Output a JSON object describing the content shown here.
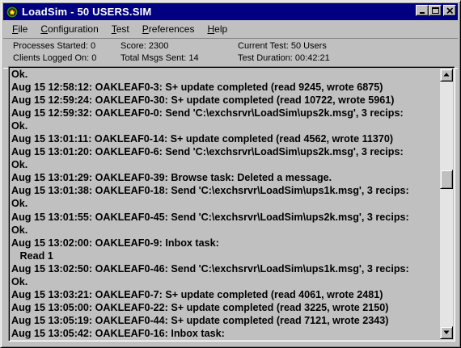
{
  "window": {
    "title": "LoadSim - 50 USERS.SIM",
    "icon": "loadsim-app-icon",
    "buttons": [
      "minimize-icon",
      "maximize-icon",
      "close-icon"
    ]
  },
  "menu": {
    "items": [
      {
        "label": "File",
        "accel": "F"
      },
      {
        "label": "Configuration",
        "accel": "C"
      },
      {
        "label": "Test",
        "accel": "T"
      },
      {
        "label": "Preferences",
        "accel": "P"
      },
      {
        "label": "Help",
        "accel": "H"
      }
    ]
  },
  "status": {
    "processes_started": "Processes Started: 0",
    "clients_logged_on": "Clients Logged On: 0",
    "score": "Score: 2300",
    "total_msgs_sent": "Total Msgs Sent: 14",
    "current_test": "Current Test: 50 Users",
    "test_duration": "Test Duration: 00:42:21"
  },
  "log": {
    "lines": [
      "Ok.",
      "Aug 15 12:58:12: OAKLEAF0-3: S+ update completed (read 9245, wrote 6875)",
      "Aug 15 12:59:24: OAKLEAF0-30: S+ update completed (read 10722, wrote 5961)",
      "Aug 15 12:59:32: OAKLEAF0-0: Send 'C:\\exchsrvr\\LoadSim\\ups2k.msg', 3 recips:",
      "Ok.",
      "Aug 15 13:01:11: OAKLEAF0-14: S+ update completed (read 4562, wrote 11370)",
      "Aug 15 13:01:20: OAKLEAF0-6: Send 'C:\\exchsrvr\\LoadSim\\ups2k.msg', 3 recips:",
      "Ok.",
      "Aug 15 13:01:29: OAKLEAF0-39: Browse task: Deleted a message.",
      "Aug 15 13:01:38: OAKLEAF0-18: Send 'C:\\exchsrvr\\LoadSim\\ups1k.msg', 3 recips:",
      "Ok.",
      "Aug 15 13:01:55: OAKLEAF0-45: Send 'C:\\exchsrvr\\LoadSim\\ups2k.msg', 3 recips:",
      "Ok.",
      "Aug 15 13:02:00: OAKLEAF0-9: Inbox task:",
      "   Read 1",
      "Aug 15 13:02:50: OAKLEAF0-46: Send 'C:\\exchsrvr\\LoadSim\\ups1k.msg', 3 recips:",
      "Ok.",
      "Aug 15 13:03:21: OAKLEAF0-7: S+ update completed (read 4061, wrote 2481)",
      "Aug 15 13:05:00: OAKLEAF0-22: S+ update completed (read 3225, wrote 2150)",
      "Aug 15 13:05:19: OAKLEAF0-44: S+ update completed (read 7121, wrote 2343)",
      "Aug 15 13:05:42: OAKLEAF0-16: Inbox task:"
    ]
  },
  "scrollbar": {
    "position_fraction": 0.39,
    "icons": [
      "scroll-up-arrow-icon",
      "scroll-down-arrow-icon"
    ]
  },
  "colors": {
    "titlebar": "#000080",
    "face": "#c0c0c0",
    "scroll_track": "#e4e4e4"
  }
}
